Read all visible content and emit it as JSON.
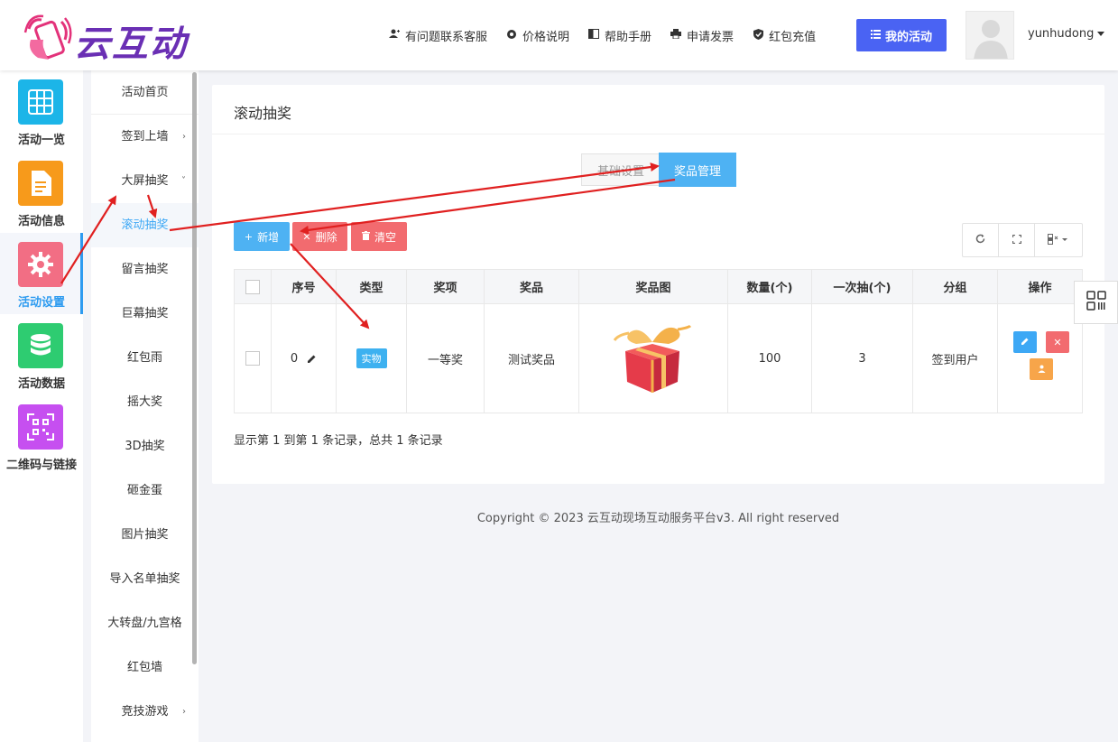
{
  "brand": {
    "name": "云互动"
  },
  "top_nav": [
    {
      "icon": "user-plus-icon",
      "label": "有问题联系客服"
    },
    {
      "icon": "gear-icon",
      "label": "价格说明"
    },
    {
      "icon": "book-icon",
      "label": "帮助手册"
    },
    {
      "icon": "printer-icon",
      "label": "申请发票"
    },
    {
      "icon": "shield-check-icon",
      "label": "红包充值"
    }
  ],
  "my_activity_label": "我的活动",
  "user": {
    "name": "yunhudong"
  },
  "iconbar": [
    {
      "label": "活动一览",
      "color": "#1cb5e8",
      "icon": "grid-icon"
    },
    {
      "label": "活动信息",
      "color": "#f79a1b",
      "icon": "document-icon"
    },
    {
      "label": "活动设置",
      "color": "#f26e84",
      "icon": "gear-icon",
      "active": true
    },
    {
      "label": "活动数据",
      "color": "#2ecc71",
      "icon": "database-icon"
    },
    {
      "label": "二维码与链接",
      "color": "#c64ff0",
      "icon": "qrcode-icon"
    }
  ],
  "submenu": [
    {
      "label": "活动首页"
    },
    {
      "label": "签到上墙",
      "arrow": "›"
    },
    {
      "label": "大屏抽奖",
      "arrow": "˅"
    },
    {
      "label": "滚动抽奖",
      "active": true
    },
    {
      "label": "留言抽奖"
    },
    {
      "label": "巨幕抽奖"
    },
    {
      "label": "红包雨"
    },
    {
      "label": "摇大奖"
    },
    {
      "label": "3D抽奖"
    },
    {
      "label": "砸金蛋"
    },
    {
      "label": "图片抽奖"
    },
    {
      "label": "导入名单抽奖"
    },
    {
      "label": "大转盘/九宫格"
    },
    {
      "label": "红包墙"
    },
    {
      "label": "竞技游戏",
      "arrow": "›"
    }
  ],
  "panel": {
    "title": "滚动抽奖",
    "tabs": {
      "basic": "基础设置",
      "prize": "奖品管理"
    },
    "buttons": {
      "add": "新增",
      "delete": "删除",
      "clear": "清空"
    }
  },
  "table": {
    "headers": [
      "序号",
      "类型",
      "奖项",
      "奖品",
      "奖品图",
      "数量(个)",
      "一次抽(个)",
      "分组",
      "操作"
    ],
    "rows": [
      {
        "index": "0",
        "type": "实物",
        "award": "一等奖",
        "prize": "测试奖品",
        "qty": "100",
        "per_draw": "3",
        "group": "签到用户"
      }
    ]
  },
  "pager_text": "显示第 1 到第 1 条记录，总共 1 条记录",
  "copyright": "Copyright © 2023 云互动现场互动服务平台v3. All right reserved"
}
